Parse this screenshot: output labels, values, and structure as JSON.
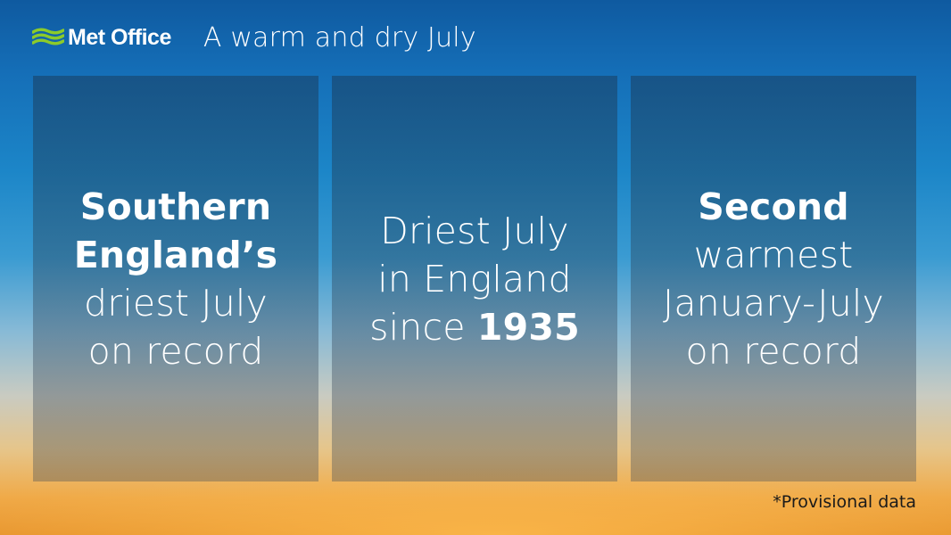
{
  "header": {
    "brand": "Met Office",
    "title": "A warm and dry July",
    "logo_icon": "met-office-wave-icon",
    "logo_color": "#8ccb2a"
  },
  "panels": [
    {
      "lines": [
        {
          "bold": "Southern"
        },
        {
          "bold": "England’s"
        },
        {
          "text": "driest July"
        },
        {
          "text": "on record"
        }
      ]
    },
    {
      "lines": [
        {
          "text": "Driest July"
        },
        {
          "text": "in England"
        },
        {
          "text": "since ",
          "bold": "1935"
        }
      ]
    },
    {
      "lines": [
        {
          "bold": "Second"
        },
        {
          "text": "warmest"
        },
        {
          "text": "January-July"
        },
        {
          "text": "on record"
        }
      ]
    }
  ],
  "footnote": "*Provisional data"
}
